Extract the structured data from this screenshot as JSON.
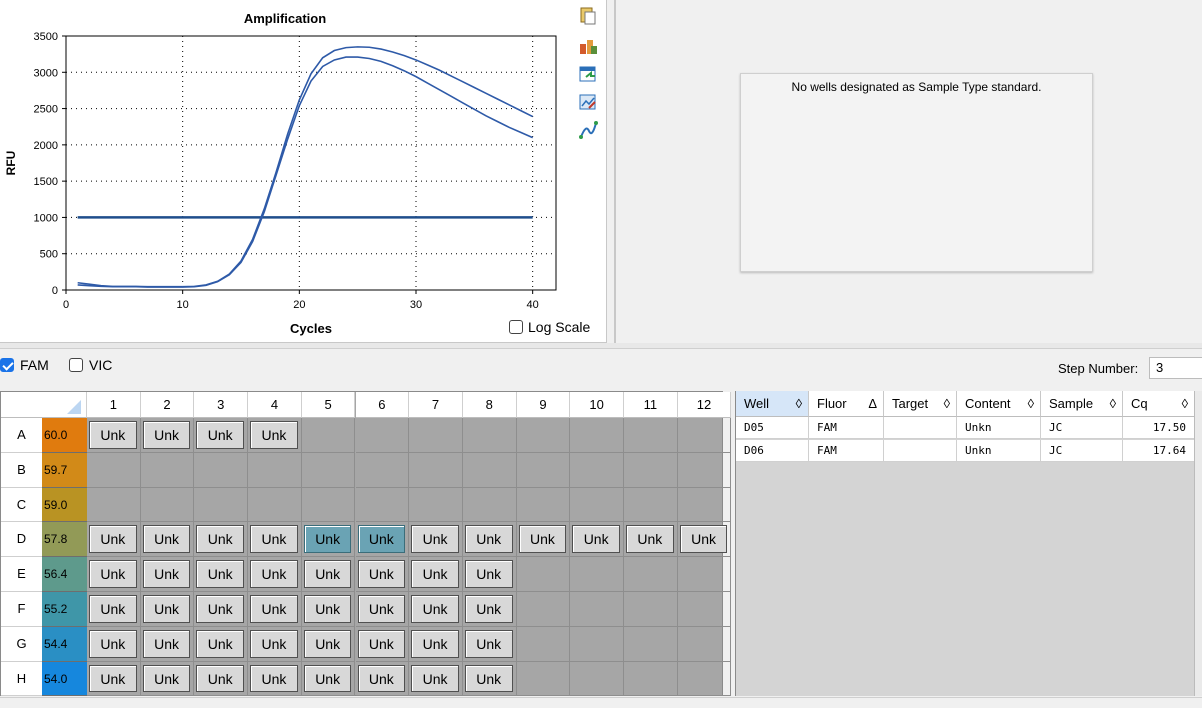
{
  "chart": {
    "title": "Amplification",
    "xlabel": "Cycles",
    "ylabel": "RFU",
    "log_scale_label": "Log Scale",
    "log_scale_checked": false
  },
  "chart_data": {
    "type": "line",
    "title": "Amplification",
    "xlabel": "Cycles",
    "ylabel": "RFU",
    "xlim": [
      0,
      42
    ],
    "ylim": [
      0,
      3500
    ],
    "xticks": [
      0,
      10,
      20,
      30,
      40
    ],
    "yticks": [
      0,
      500,
      1000,
      1500,
      2000,
      2500,
      3000,
      3500
    ],
    "grid": true,
    "series": [
      {
        "x": [
          1,
          2,
          3,
          4,
          5,
          6,
          7,
          8,
          9,
          10,
          11,
          12,
          13,
          14,
          15,
          16,
          17,
          18,
          19,
          20,
          21,
          22,
          23,
          24,
          25,
          26,
          27,
          28,
          29,
          30,
          31,
          32,
          33,
          34,
          35,
          36,
          37,
          38,
          39,
          40
        ],
        "values": [
          100,
          80,
          60,
          50,
          50,
          50,
          45,
          45,
          45,
          45,
          50,
          70,
          120,
          220,
          400,
          700,
          1120,
          1620,
          2150,
          2620,
          2980,
          3200,
          3300,
          3340,
          3350,
          3345,
          3320,
          3280,
          3230,
          3170,
          3100,
          3030,
          2950,
          2870,
          2790,
          2710,
          2630,
          2550,
          2470,
          2390
        ]
      },
      {
        "x": [
          1,
          2,
          3,
          4,
          5,
          6,
          7,
          8,
          9,
          10,
          11,
          12,
          13,
          14,
          15,
          16,
          17,
          18,
          19,
          20,
          21,
          22,
          23,
          24,
          25,
          26,
          27,
          28,
          29,
          30,
          31,
          32,
          33,
          34,
          35,
          36,
          37,
          38,
          39,
          40
        ],
        "values": [
          70,
          60,
          50,
          45,
          45,
          45,
          40,
          40,
          40,
          40,
          45,
          65,
          115,
          210,
          380,
          670,
          1080,
          1580,
          2080,
          2540,
          2880,
          3080,
          3170,
          3210,
          3210,
          3190,
          3150,
          3090,
          3020,
          2940,
          2850,
          2760,
          2670,
          2580,
          2490,
          2400,
          2320,
          2240,
          2170,
          2100
        ]
      }
    ],
    "threshold": 1000,
    "colors": {
      "curve": "#2e5aa8",
      "threshold": "#1f4e8c"
    }
  },
  "standard_curve": {
    "message": "No wells designated as Sample Type standard."
  },
  "fluor_bar": {
    "fam_label": "FAM",
    "fam_checked": true,
    "vic_label": "VIC",
    "vic_checked": false,
    "step_label": "Step Number:",
    "step_value": "3"
  },
  "plate": {
    "columns": [
      "1",
      "2",
      "3",
      "4",
      "5",
      "6",
      "7",
      "8",
      "9",
      "10",
      "11",
      "12"
    ],
    "rows": [
      {
        "label": "A",
        "temp": "60.0",
        "temp_color": "#e07b0e",
        "wells": [
          "Unk",
          "Unk",
          "Unk",
          "Unk",
          "",
          "",
          "",
          "",
          "",
          "",
          "",
          ""
        ]
      },
      {
        "label": "B",
        "temp": "59.7",
        "temp_color": "#d28a18",
        "wells": [
          "",
          "",
          "",
          "",
          "",
          "",
          "",
          "",
          "",
          "",
          "",
          ""
        ]
      },
      {
        "label": "C",
        "temp": "59.0",
        "temp_color": "#b99323",
        "wells": [
          "",
          "",
          "",
          "",
          "",
          "",
          "",
          "",
          "",
          "",
          "",
          ""
        ]
      },
      {
        "label": "D",
        "temp": "57.8",
        "temp_color": "#929a57",
        "wells": [
          "Unk",
          "Unk",
          "Unk",
          "Unk",
          "Unk",
          "Unk",
          "Unk",
          "Unk",
          "Unk",
          "Unk",
          "Unk",
          "Unk"
        ],
        "selected": [
          4,
          5
        ]
      },
      {
        "label": "E",
        "temp": "56.4",
        "temp_color": "#5e9a8c",
        "wells": [
          "Unk",
          "Unk",
          "Unk",
          "Unk",
          "Unk",
          "Unk",
          "Unk",
          "Unk",
          "",
          "",
          "",
          ""
        ]
      },
      {
        "label": "F",
        "temp": "55.2",
        "temp_color": "#3f96a8",
        "wells": [
          "Unk",
          "Unk",
          "Unk",
          "Unk",
          "Unk",
          "Unk",
          "Unk",
          "Unk",
          "",
          "",
          "",
          ""
        ]
      },
      {
        "label": "G",
        "temp": "54.4",
        "temp_color": "#2a8fc4",
        "wells": [
          "Unk",
          "Unk",
          "Unk",
          "Unk",
          "Unk",
          "Unk",
          "Unk",
          "Unk",
          "",
          "",
          "",
          ""
        ]
      },
      {
        "label": "H",
        "temp": "54.0",
        "temp_color": "#1687dd",
        "wells": [
          "Unk",
          "Unk",
          "Unk",
          "Unk",
          "Unk",
          "Unk",
          "Unk",
          "Unk",
          "",
          "",
          "",
          ""
        ]
      }
    ]
  },
  "results_table": {
    "headers": [
      {
        "label": "Well",
        "sort": "◊"
      },
      {
        "label": "Fluor",
        "sort": "Δ"
      },
      {
        "label": "Target",
        "sort": "◊"
      },
      {
        "label": "Content",
        "sort": "◊"
      },
      {
        "label": "Sample",
        "sort": "◊"
      },
      {
        "label": "Cq",
        "sort": "◊"
      }
    ],
    "rows": [
      [
        "D05",
        "FAM",
        "",
        "Unkn",
        "JC",
        "17.50"
      ],
      [
        "D06",
        "FAM",
        "",
        "Unkn",
        "JC",
        "17.64"
      ]
    ]
  },
  "toolbar_icons": [
    "copy-icon",
    "export-icon",
    "refresh-chart-icon",
    "chart-settings-icon",
    "curve-tool-icon"
  ]
}
